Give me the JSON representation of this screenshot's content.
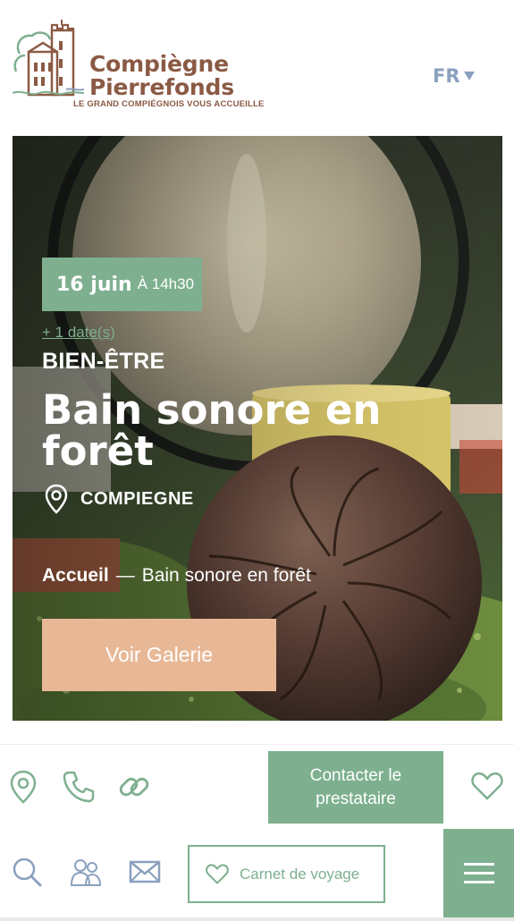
{
  "header": {
    "logo_line1": "Compiègne",
    "logo_line2": "Pierrefonds",
    "logo_tagline": "LE GRAND COMPIÉGNOIS VOUS ACCUEILLE",
    "language": "FR"
  },
  "event": {
    "date": "16 juin",
    "time": "À 14h30",
    "more_dates": "+ 1 date(s)",
    "category": "BIEN-ÊTRE",
    "title": "Bain sonore en forêt",
    "location": "COMPIEGNE"
  },
  "breadcrumb": {
    "home": "Accueil",
    "separator": "—",
    "current": "Bain sonore en forêt"
  },
  "gallery_button": "Voir Galerie",
  "action_bar": {
    "contact_button": "Contacter le prestataire",
    "carnet_button": "Carnet de voyage"
  },
  "icons": {
    "row1": [
      "map-pin-icon",
      "phone-icon",
      "link-icon",
      "heart-icon"
    ],
    "row2": [
      "search-icon",
      "people-icon",
      "mail-icon",
      "heart-icon",
      "menu-icon"
    ]
  },
  "colors": {
    "brand_green": "#7eb08f",
    "brand_brown": "#8b5a44",
    "accent_peach": "#e8b896",
    "lang_blue": "#8aa0bf"
  }
}
